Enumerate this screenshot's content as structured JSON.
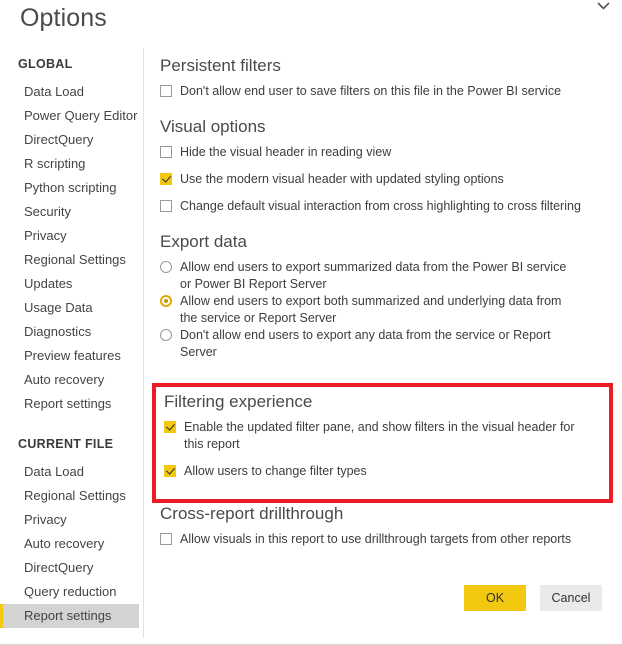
{
  "dialog": {
    "title": "Options",
    "close_icon": "close-icon"
  },
  "sidebar": {
    "groups": [
      {
        "header": "GLOBAL",
        "items": [
          {
            "label": "Data Load",
            "selected": false
          },
          {
            "label": "Power Query Editor",
            "selected": false
          },
          {
            "label": "DirectQuery",
            "selected": false
          },
          {
            "label": "R scripting",
            "selected": false
          },
          {
            "label": "Python scripting",
            "selected": false
          },
          {
            "label": "Security",
            "selected": false
          },
          {
            "label": "Privacy",
            "selected": false
          },
          {
            "label": "Regional Settings",
            "selected": false
          },
          {
            "label": "Updates",
            "selected": false
          },
          {
            "label": "Usage Data",
            "selected": false
          },
          {
            "label": "Diagnostics",
            "selected": false
          },
          {
            "label": "Preview features",
            "selected": false
          },
          {
            "label": "Auto recovery",
            "selected": false
          },
          {
            "label": "Report settings",
            "selected": false
          }
        ]
      },
      {
        "header": "CURRENT FILE",
        "items": [
          {
            "label": "Data Load",
            "selected": false
          },
          {
            "label": "Regional Settings",
            "selected": false
          },
          {
            "label": "Privacy",
            "selected": false
          },
          {
            "label": "Auto recovery",
            "selected": false
          },
          {
            "label": "DirectQuery",
            "selected": false
          },
          {
            "label": "Query reduction",
            "selected": false
          },
          {
            "label": "Report settings",
            "selected": true
          }
        ]
      }
    ]
  },
  "content": {
    "persistent_filters": {
      "heading": "Persistent filters",
      "checkbox_label": "Don't allow end user to save filters on this file in the Power BI service",
      "checked": false
    },
    "visual_options": {
      "heading": "Visual options",
      "items": [
        {
          "label": "Hide the visual header in reading view",
          "checked": false
        },
        {
          "label": "Use the modern visual header with updated styling options",
          "checked": true
        },
        {
          "label": "Change default visual interaction from cross highlighting to cross filtering",
          "checked": false
        }
      ]
    },
    "export_data": {
      "heading": "Export data",
      "options": [
        {
          "label": "Allow end users to export summarized data from the Power BI service or Power BI Report Server",
          "selected": false
        },
        {
          "label": "Allow end users to export both summarized and underlying data from the service or Report Server",
          "selected": true
        },
        {
          "label": "Don't allow end users to export any data from the service or Report Server",
          "selected": false
        }
      ]
    },
    "filtering_experience": {
      "heading": "Filtering experience",
      "items": [
        {
          "label": "Enable the updated filter pane, and show filters in the visual header for this report",
          "checked": true
        },
        {
          "label": "Allow users to change filter types",
          "checked": true
        }
      ]
    },
    "cross_report_drillthrough": {
      "heading": "Cross-report drillthrough",
      "checkbox_label": "Allow visuals in this report to use drillthrough targets from other reports",
      "checked": false
    }
  },
  "buttons": {
    "ok": "OK",
    "cancel": "Cancel"
  },
  "annotation": {
    "highlight_color": "#ed1c24"
  },
  "colors": {
    "accent": "#f2c811",
    "selected_nav_bg": "#d3d3d3"
  }
}
